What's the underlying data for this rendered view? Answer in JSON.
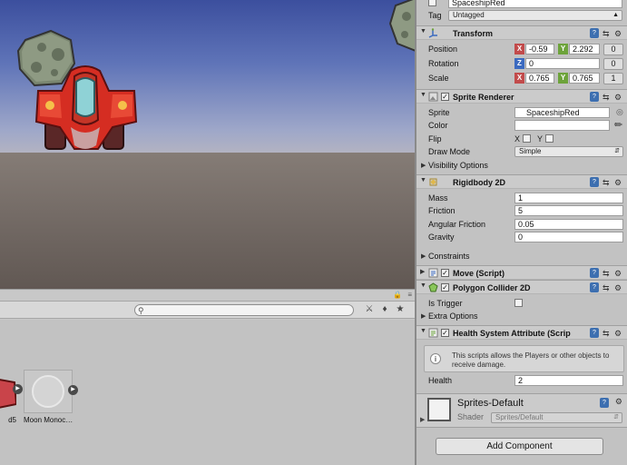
{
  "colors": {
    "accent_x": "#c24b4b",
    "accent_y": "#6da33b",
    "accent_z": "#3b6ac0",
    "help": "#3d6fb0"
  },
  "project": {
    "assets": [
      {
        "label": "d5"
      },
      {
        "label": "Moon Monoc…"
      }
    ]
  },
  "inspector": {
    "object_name": "SpaceshipRed",
    "tag_label": "Tag",
    "tag_value": "Untagged",
    "transform": {
      "title": "Transform",
      "position_label": "Position",
      "position_x": "-0.59",
      "position_y": "2.292",
      "position_z": "0",
      "rotation_label": "Rotation",
      "rotation_z": "0",
      "rotation_w": "0",
      "scale_label": "Scale",
      "scale_x": "0.765",
      "scale_y": "0.765",
      "scale_z": "1"
    },
    "sprite_renderer": {
      "title": "Sprite Renderer",
      "sprite_label": "Sprite",
      "sprite_value": "SpaceshipRed",
      "color_label": "Color",
      "flip_label": "Flip",
      "flip_x": "X",
      "flip_y": "Y",
      "draw_mode_label": "Draw Mode",
      "draw_mode_value": "Simple",
      "visibility_label": "Visibility Options"
    },
    "rigidbody": {
      "title": "Rigidbody 2D",
      "mass_label": "Mass",
      "mass_value": "1",
      "friction_label": "Friction",
      "friction_value": "5",
      "angular_label": "Angular Friction",
      "angular_value": "0.05",
      "gravity_label": "Gravity",
      "gravity_value": "0",
      "constraints_label": "Constraints"
    },
    "move": {
      "title": "Move (Script)"
    },
    "polygon": {
      "title": "Polygon Collider 2D",
      "trigger_label": "Is Trigger",
      "extra_label": "Extra Options"
    },
    "health": {
      "title": "Health System Attribute (Scrip",
      "info": "This scripts allows the Players or other objects to receive damage.",
      "health_label": "Health",
      "health_value": "2"
    },
    "material": {
      "name": "Sprites-Default",
      "shader_label": "Shader",
      "shader_value": "Sprites/Default"
    },
    "add_component": "Add Component"
  }
}
